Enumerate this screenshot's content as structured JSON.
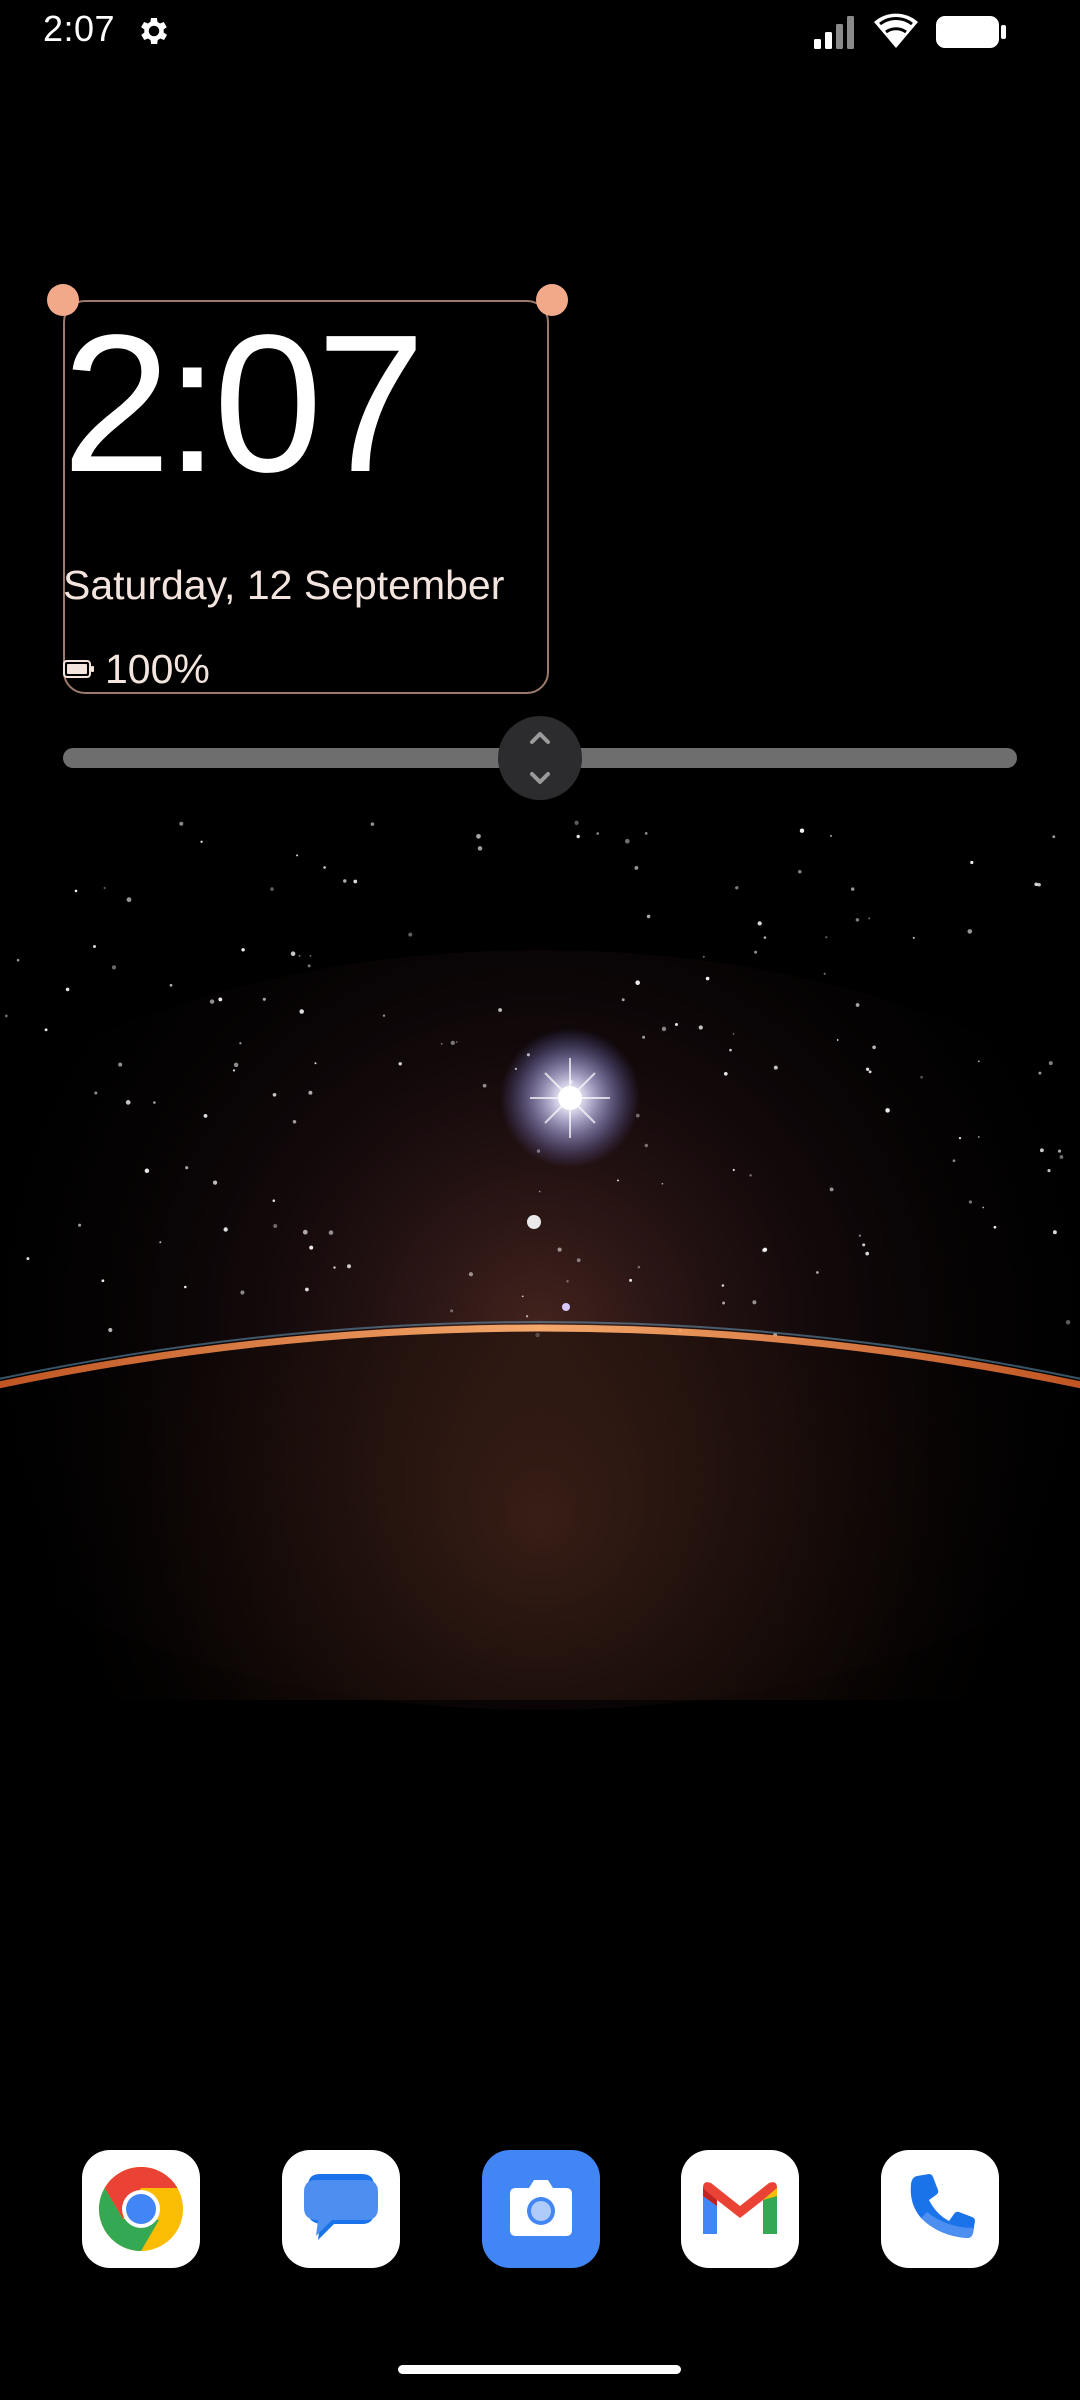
{
  "status_bar": {
    "time": "2:07",
    "settings_icon": "gear-icon",
    "signal_icon": "cellular-signal-icon",
    "wifi_icon": "wifi-icon",
    "battery_icon": "battery-full-icon"
  },
  "clock_widget": {
    "time": "2:07",
    "date": "Saturday, 12 September",
    "battery_icon": "battery-icon",
    "battery_level": "100%"
  },
  "resize_slider": {
    "handle_icon": "expand-collapse-icon"
  },
  "dock": {
    "apps": [
      {
        "name": "Chrome",
        "icon": "chrome-icon"
      },
      {
        "name": "Messages",
        "icon": "messages-icon"
      },
      {
        "name": "Camera",
        "icon": "camera-icon"
      },
      {
        "name": "Gmail",
        "icon": "gmail-icon"
      },
      {
        "name": "Phone",
        "icon": "phone-icon"
      }
    ]
  },
  "colors": {
    "widget_border": "#9b7a6b",
    "handle": "#f2a98a",
    "date_text": "#f4e4de",
    "slider_track": "#6e6e6e",
    "horizon_glow": "#e8742a"
  }
}
